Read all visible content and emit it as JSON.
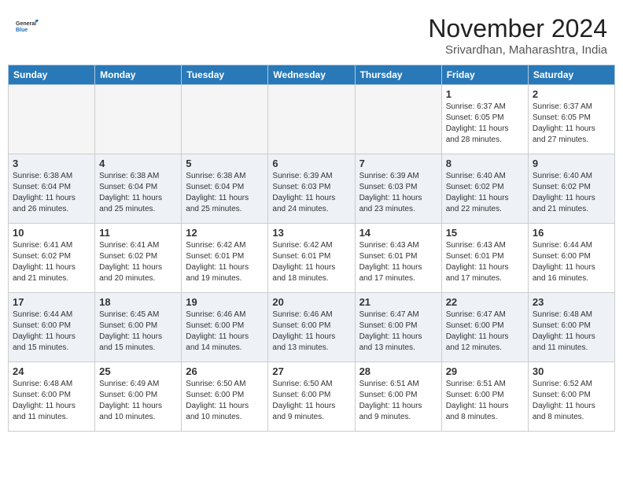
{
  "header": {
    "logo_general": "General",
    "logo_blue": "Blue",
    "month_title": "November 2024",
    "location": "Srivardhan, Maharashtra, India"
  },
  "days_of_week": [
    "Sunday",
    "Monday",
    "Tuesday",
    "Wednesday",
    "Thursday",
    "Friday",
    "Saturday"
  ],
  "weeks": [
    [
      {
        "day": "",
        "info": ""
      },
      {
        "day": "",
        "info": ""
      },
      {
        "day": "",
        "info": ""
      },
      {
        "day": "",
        "info": ""
      },
      {
        "day": "",
        "info": ""
      },
      {
        "day": "1",
        "info": "Sunrise: 6:37 AM\nSunset: 6:05 PM\nDaylight: 11 hours and 28 minutes."
      },
      {
        "day": "2",
        "info": "Sunrise: 6:37 AM\nSunset: 6:05 PM\nDaylight: 11 hours and 27 minutes."
      }
    ],
    [
      {
        "day": "3",
        "info": "Sunrise: 6:38 AM\nSunset: 6:04 PM\nDaylight: 11 hours and 26 minutes."
      },
      {
        "day": "4",
        "info": "Sunrise: 6:38 AM\nSunset: 6:04 PM\nDaylight: 11 hours and 25 minutes."
      },
      {
        "day": "5",
        "info": "Sunrise: 6:38 AM\nSunset: 6:04 PM\nDaylight: 11 hours and 25 minutes."
      },
      {
        "day": "6",
        "info": "Sunrise: 6:39 AM\nSunset: 6:03 PM\nDaylight: 11 hours and 24 minutes."
      },
      {
        "day": "7",
        "info": "Sunrise: 6:39 AM\nSunset: 6:03 PM\nDaylight: 11 hours and 23 minutes."
      },
      {
        "day": "8",
        "info": "Sunrise: 6:40 AM\nSunset: 6:02 PM\nDaylight: 11 hours and 22 minutes."
      },
      {
        "day": "9",
        "info": "Sunrise: 6:40 AM\nSunset: 6:02 PM\nDaylight: 11 hours and 21 minutes."
      }
    ],
    [
      {
        "day": "10",
        "info": "Sunrise: 6:41 AM\nSunset: 6:02 PM\nDaylight: 11 hours and 21 minutes."
      },
      {
        "day": "11",
        "info": "Sunrise: 6:41 AM\nSunset: 6:02 PM\nDaylight: 11 hours and 20 minutes."
      },
      {
        "day": "12",
        "info": "Sunrise: 6:42 AM\nSunset: 6:01 PM\nDaylight: 11 hours and 19 minutes."
      },
      {
        "day": "13",
        "info": "Sunrise: 6:42 AM\nSunset: 6:01 PM\nDaylight: 11 hours and 18 minutes."
      },
      {
        "day": "14",
        "info": "Sunrise: 6:43 AM\nSunset: 6:01 PM\nDaylight: 11 hours and 17 minutes."
      },
      {
        "day": "15",
        "info": "Sunrise: 6:43 AM\nSunset: 6:01 PM\nDaylight: 11 hours and 17 minutes."
      },
      {
        "day": "16",
        "info": "Sunrise: 6:44 AM\nSunset: 6:00 PM\nDaylight: 11 hours and 16 minutes."
      }
    ],
    [
      {
        "day": "17",
        "info": "Sunrise: 6:44 AM\nSunset: 6:00 PM\nDaylight: 11 hours and 15 minutes."
      },
      {
        "day": "18",
        "info": "Sunrise: 6:45 AM\nSunset: 6:00 PM\nDaylight: 11 hours and 15 minutes."
      },
      {
        "day": "19",
        "info": "Sunrise: 6:46 AM\nSunset: 6:00 PM\nDaylight: 11 hours and 14 minutes."
      },
      {
        "day": "20",
        "info": "Sunrise: 6:46 AM\nSunset: 6:00 PM\nDaylight: 11 hours and 13 minutes."
      },
      {
        "day": "21",
        "info": "Sunrise: 6:47 AM\nSunset: 6:00 PM\nDaylight: 11 hours and 13 minutes."
      },
      {
        "day": "22",
        "info": "Sunrise: 6:47 AM\nSunset: 6:00 PM\nDaylight: 11 hours and 12 minutes."
      },
      {
        "day": "23",
        "info": "Sunrise: 6:48 AM\nSunset: 6:00 PM\nDaylight: 11 hours and 11 minutes."
      }
    ],
    [
      {
        "day": "24",
        "info": "Sunrise: 6:48 AM\nSunset: 6:00 PM\nDaylight: 11 hours and 11 minutes."
      },
      {
        "day": "25",
        "info": "Sunrise: 6:49 AM\nSunset: 6:00 PM\nDaylight: 11 hours and 10 minutes."
      },
      {
        "day": "26",
        "info": "Sunrise: 6:50 AM\nSunset: 6:00 PM\nDaylight: 11 hours and 10 minutes."
      },
      {
        "day": "27",
        "info": "Sunrise: 6:50 AM\nSunset: 6:00 PM\nDaylight: 11 hours and 9 minutes."
      },
      {
        "day": "28",
        "info": "Sunrise: 6:51 AM\nSunset: 6:00 PM\nDaylight: 11 hours and 9 minutes."
      },
      {
        "day": "29",
        "info": "Sunrise: 6:51 AM\nSunset: 6:00 PM\nDaylight: 11 hours and 8 minutes."
      },
      {
        "day": "30",
        "info": "Sunrise: 6:52 AM\nSunset: 6:00 PM\nDaylight: 11 hours and 8 minutes."
      }
    ]
  ]
}
